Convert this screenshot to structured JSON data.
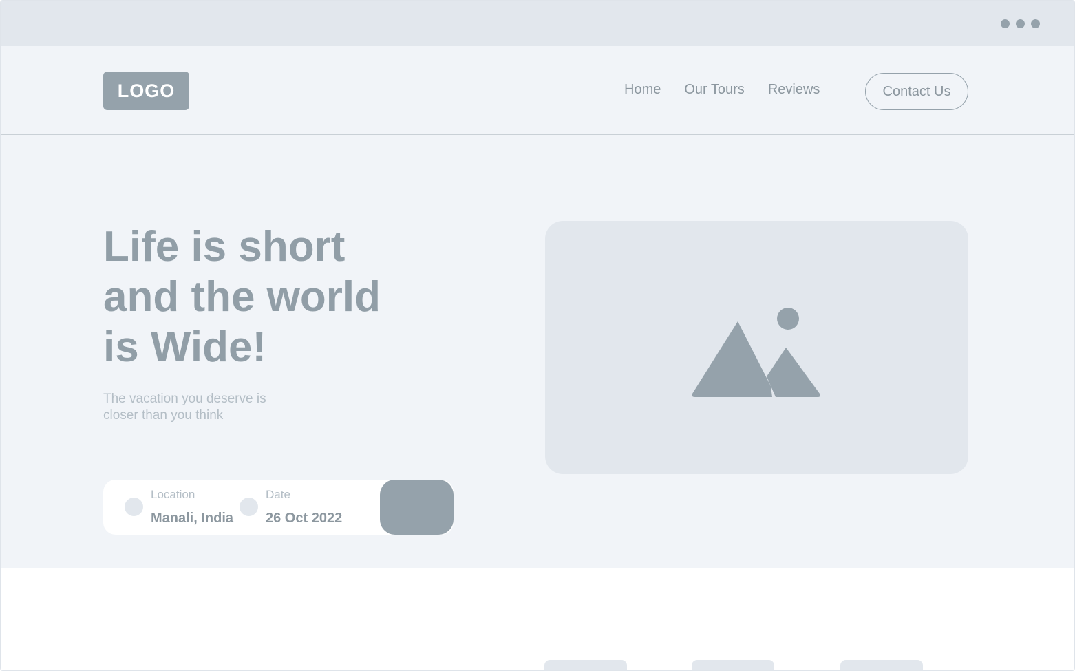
{
  "window": {
    "controls_icon": "more-dots-icon"
  },
  "navbar": {
    "logo": "LOGO",
    "links": [
      "Home",
      "Our Tours",
      "Reviews"
    ],
    "contact_label": "Contact Us"
  },
  "hero": {
    "title_lines": [
      "Life is short",
      "and the world",
      "is Wide!"
    ],
    "subtitle_lines": [
      "The vacation you deserve is",
      "closer than you think"
    ],
    "image_icon": "image-placeholder-icon"
  },
  "search": {
    "location_label": "Location",
    "location_value": "Manali, India",
    "date_label": "Date",
    "date_value": "26 Oct 2022"
  },
  "colors": {
    "accent": "#95a2ab",
    "background": "#f1f4f8",
    "placeholder": "#e2e7ed"
  }
}
